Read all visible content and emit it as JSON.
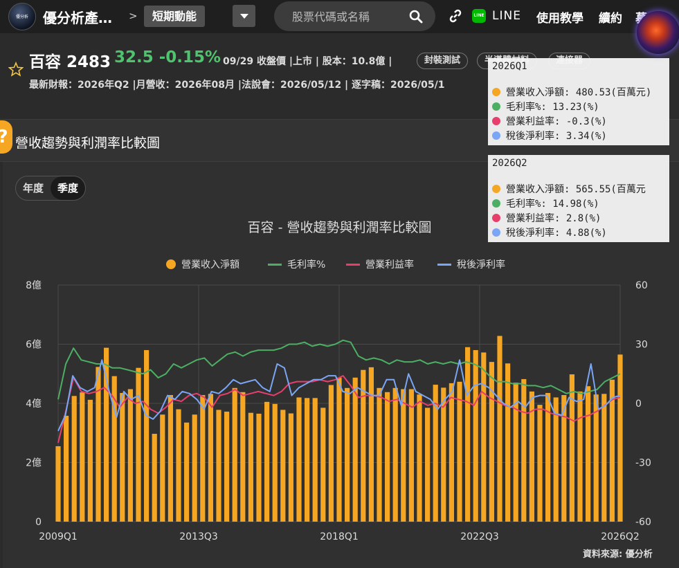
{
  "nav": {
    "logo_text": "優分析",
    "site_title": "優分析產…",
    "crumb_sep": ">",
    "crumb_current": "短期動能",
    "search_placeholder": "股票代碼或名稱",
    "line_label": "LINE",
    "links": [
      "使用教學",
      "續約",
      "募"
    ]
  },
  "stock": {
    "name": "百容 2483",
    "price_change": "32.5 -0.15%",
    "meta": "09/29 收盤價 |上市 | 股本：10.8億 |",
    "pills": [
      "封裝測試",
      "半導體材料",
      "連接器"
    ],
    "subline": "最新財報：2026年Q2 |月營收：2026年08月 |法說會：2026/05/12 | 逐字稿：2026/05/1"
  },
  "section": {
    "help": "?",
    "title": "營收趨勢與利潤率比較圖"
  },
  "toggle": {
    "year": "年度",
    "quarter": "季度"
  },
  "source": "資料來源: 優分析",
  "tooltips": [
    {
      "title": "2026Q1",
      "rows": [
        {
          "label": "營業收入淨額: 480.53(百萬元)",
          "color": "#f5a623"
        },
        {
          "label": "毛利率%: 13.23(%)",
          "color": "#4caf63"
        },
        {
          "label": "營業利益率: -0.3(%)",
          "color": "#e83e6c"
        },
        {
          "label": "稅後淨利率: 3.34(%)",
          "color": "#7aa6f5"
        }
      ]
    },
    {
      "title": "2026Q2",
      "rows": [
        {
          "label": "營業收入淨額: 565.55(百萬元",
          "color": "#f5a623"
        },
        {
          "label": "毛利率%: 14.98(%)",
          "color": "#4caf63"
        },
        {
          "label": "營業利益率: 2.8(%)",
          "color": "#e83e6c"
        },
        {
          "label": "稅後淨利率: 4.88(%)",
          "color": "#7aa6f5"
        }
      ]
    }
  ],
  "chart_data": {
    "type": "bar",
    "title": "百容 - 營收趨勢與利潤率比較圖",
    "x_tick_labels": [
      "2009Q1",
      "2013Q3",
      "2018Q1",
      "2022Q3",
      "2026Q2"
    ],
    "y_left_ticks": [
      "0",
      "2億",
      "4億",
      "6億",
      "8億"
    ],
    "y_left_range": [
      0,
      800
    ],
    "y_right_ticks": [
      "-60",
      "-30",
      "0",
      "30",
      "60"
    ],
    "y_right_range": [
      -60,
      60
    ],
    "colors": {
      "revenue": "#f5a623",
      "gross": "#4caf63",
      "operating": "#e83e6c",
      "net": "#7aa6f5"
    },
    "series": [
      {
        "name": "營業收入淨額",
        "axis": "left",
        "values": [
          255,
          358,
          425,
          437,
          412,
          523,
          588,
          492,
          435,
          448,
          520,
          580,
          297,
          362,
          428,
          380,
          335,
          362,
          428,
          432,
          378,
          372,
          452,
          438,
          368,
          365,
          405,
          398,
          378,
          366,
          420,
          418,
          418,
          385,
          462,
          487,
          452,
          487,
          513,
          522,
          452,
          438,
          452,
          448,
          448,
          430,
          385,
          463,
          453,
          468,
          473,
          590,
          580,
          572,
          540,
          628,
          535,
          470,
          482,
          440,
          395,
          435,
          420,
          428,
          498,
          440,
          458,
          430,
          432,
          480,
          565
        ]
      },
      {
        "name": "毛利率%",
        "axis": "right",
        "values": [
          2,
          20,
          28,
          22,
          21,
          20,
          20,
          18,
          18,
          17,
          16,
          15,
          17,
          13,
          15,
          20,
          18,
          20,
          22,
          23,
          19,
          22,
          25,
          26,
          24,
          26,
          27,
          27,
          27,
          28,
          30,
          30,
          31,
          29,
          30,
          29,
          30,
          32,
          31,
          24,
          22,
          23,
          22,
          20,
          22,
          21,
          21,
          22,
          20,
          21,
          20,
          21,
          20,
          21,
          20,
          18,
          14,
          11,
          11,
          10,
          10,
          9,
          9,
          8,
          9,
          7,
          5,
          6,
          5,
          6,
          7,
          11,
          13,
          15
        ]
      },
      {
        "name": "營業利益率",
        "axis": "right",
        "values": [
          -20,
          -4,
          13,
          6,
          5,
          6,
          8,
          4,
          -2,
          3,
          0,
          1,
          -3,
          -5,
          -2,
          2,
          1,
          4,
          5,
          3,
          -2,
          4,
          5,
          7,
          4,
          5,
          6,
          5,
          4,
          6,
          10,
          11,
          11,
          11,
          12,
          11,
          12,
          14,
          9,
          3,
          4,
          4,
          3,
          1,
          2,
          0,
          -2,
          1,
          -1,
          0,
          -2,
          3,
          2,
          1,
          -1,
          6,
          3,
          1,
          -1,
          -2,
          -4,
          -5,
          -3,
          -3,
          -5,
          -6,
          -7,
          -9,
          -7,
          -6,
          -4,
          -1,
          2,
          3
        ]
      },
      {
        "name": "稅後淨利率",
        "axis": "right",
        "values": [
          -14,
          -6,
          14,
          8,
          6,
          8,
          22,
          6,
          -7,
          6,
          2,
          4,
          -6,
          -8,
          -4,
          4,
          2,
          6,
          5,
          2,
          -3,
          6,
          5,
          8,
          12,
          10,
          11,
          12,
          8,
          6,
          20,
          18,
          4,
          8,
          10,
          12,
          12,
          14,
          14,
          6,
          5,
          8,
          6,
          4,
          4,
          12,
          12,
          -1,
          15,
          6,
          4,
          2,
          -3,
          2,
          6,
          22,
          4,
          9,
          10,
          8,
          4,
          0,
          -2,
          1,
          -2,
          3,
          4,
          4,
          -5,
          -6,
          3,
          1,
          2,
          20,
          -3,
          -1,
          3,
          4
        ]
      }
    ]
  }
}
